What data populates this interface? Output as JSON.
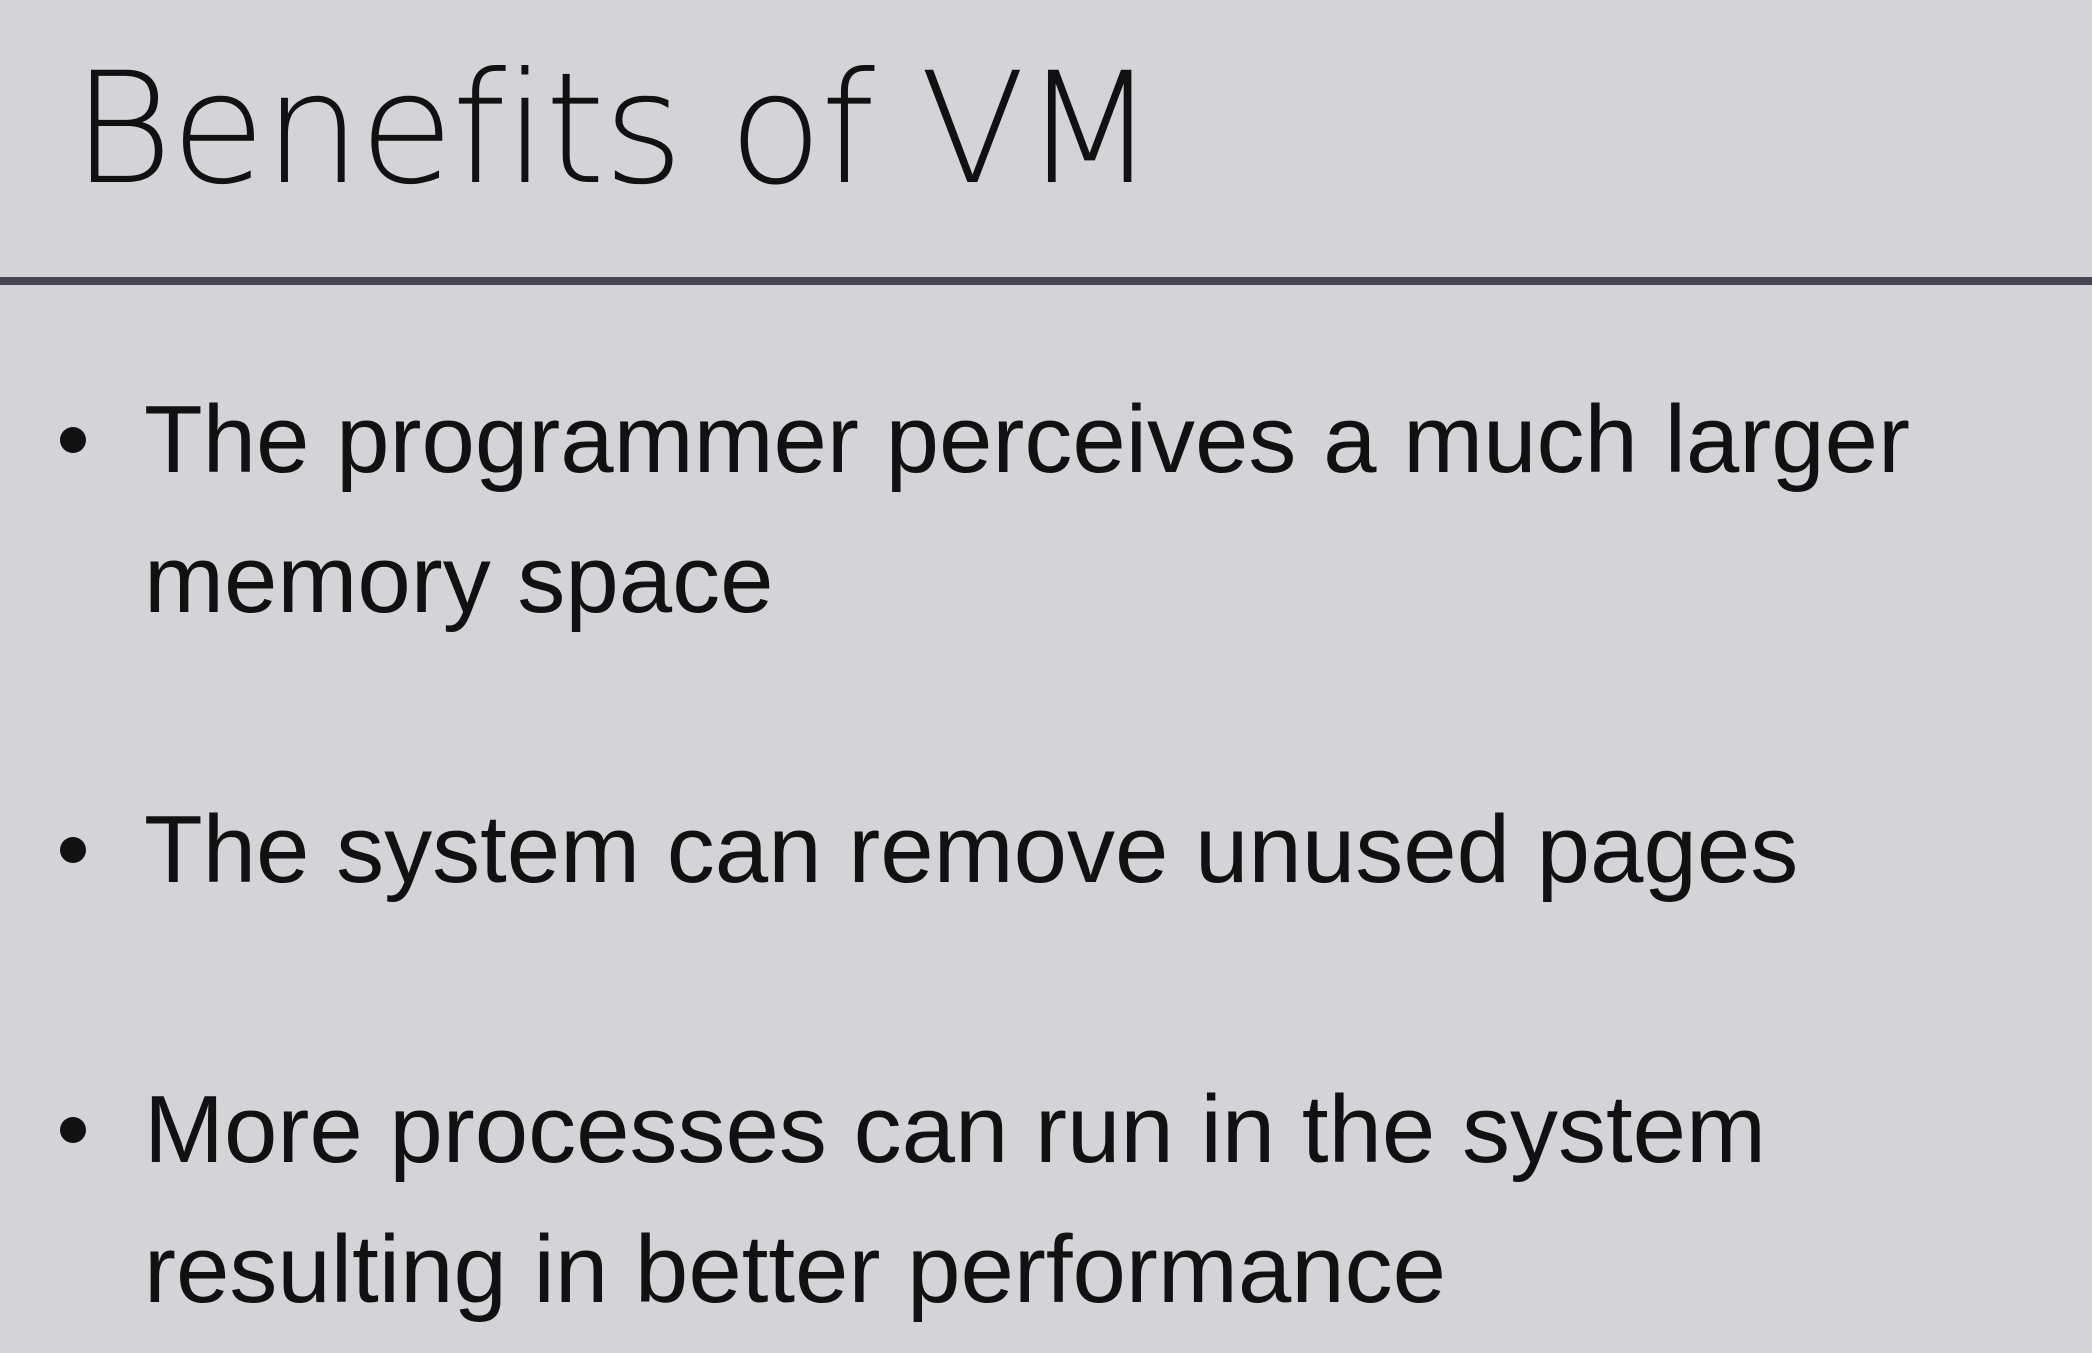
{
  "slide": {
    "title": "Benefits of VM",
    "bullets": [
      "The programmer perceives a much larger memory space",
      "The system can remove unused pages",
      "More processes can run in the system resulting in better performance"
    ]
  },
  "colors": {
    "background": "#d4d4d8",
    "text": "#111111",
    "divider": "#4a4458"
  }
}
